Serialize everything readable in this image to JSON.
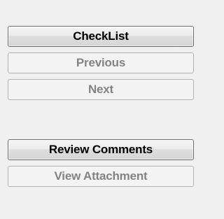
{
  "buttons": {
    "checklist": {
      "label": "CheckList",
      "enabled": true
    },
    "previous": {
      "label": "Previous",
      "enabled": false
    },
    "next": {
      "label": "Next",
      "enabled": false
    },
    "review_comments": {
      "label": "Review Comments",
      "enabled": true
    },
    "view_attachment": {
      "label": "View Attachment",
      "enabled": false
    }
  }
}
